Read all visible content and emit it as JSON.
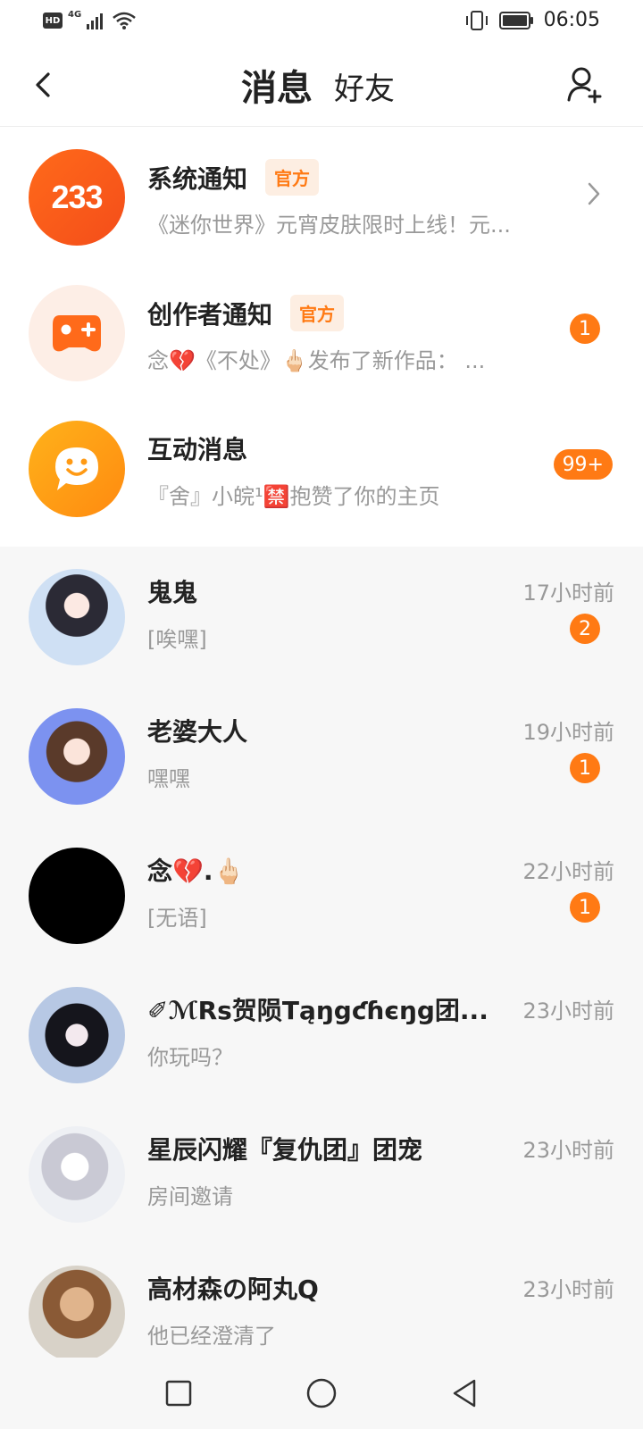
{
  "status_bar": {
    "hd_label": "HD",
    "network": "4G",
    "time": "06:05"
  },
  "header": {
    "tabs": [
      {
        "label": "消息",
        "active": true
      },
      {
        "label": "好友",
        "active": false
      }
    ],
    "accent_color": "#ff7a14"
  },
  "notifications": [
    {
      "title": "系统通知",
      "tag": "官方",
      "subtitle": "《迷你世界》元宵皮肤限时上线！元...",
      "avatar_text": "233",
      "avatar_icon": "233-logo-icon",
      "trailing": "chevron"
    },
    {
      "title": "创作者通知",
      "tag": "官方",
      "subtitle": "念💔《不处》🖕🏻发布了新作品：   ...",
      "avatar_icon": "gamepad-icon",
      "badge": "1"
    },
    {
      "title": "互动消息",
      "subtitle": "『舍』小皖¹🈲抱赞了你的主页",
      "avatar_icon": "smile-chat-icon",
      "badge": "99+"
    }
  ],
  "chats": [
    {
      "name": "鬼鬼",
      "time": "17小时前",
      "message": "[唉嘿]",
      "badge": "2"
    },
    {
      "name": "老婆大人",
      "time": "19小时前",
      "message": "嘿嘿",
      "badge": "1"
    },
    {
      "name": "念💔.🖕🏻",
      "time": "22小时前",
      "message": "[无语]",
      "badge": "1"
    },
    {
      "name": "✐ℳRs贺陨Tąŋgƈɦєŋg团...",
      "time": "23小时前",
      "message": "你玩吗？"
    },
    {
      "name": "星辰闪耀『复仇团』团宠",
      "time": "23小时前",
      "message": "房间邀请"
    },
    {
      "name": "高材森の阿丸Q",
      "time": "23小时前",
      "message": "他已经澄清了"
    }
  ]
}
